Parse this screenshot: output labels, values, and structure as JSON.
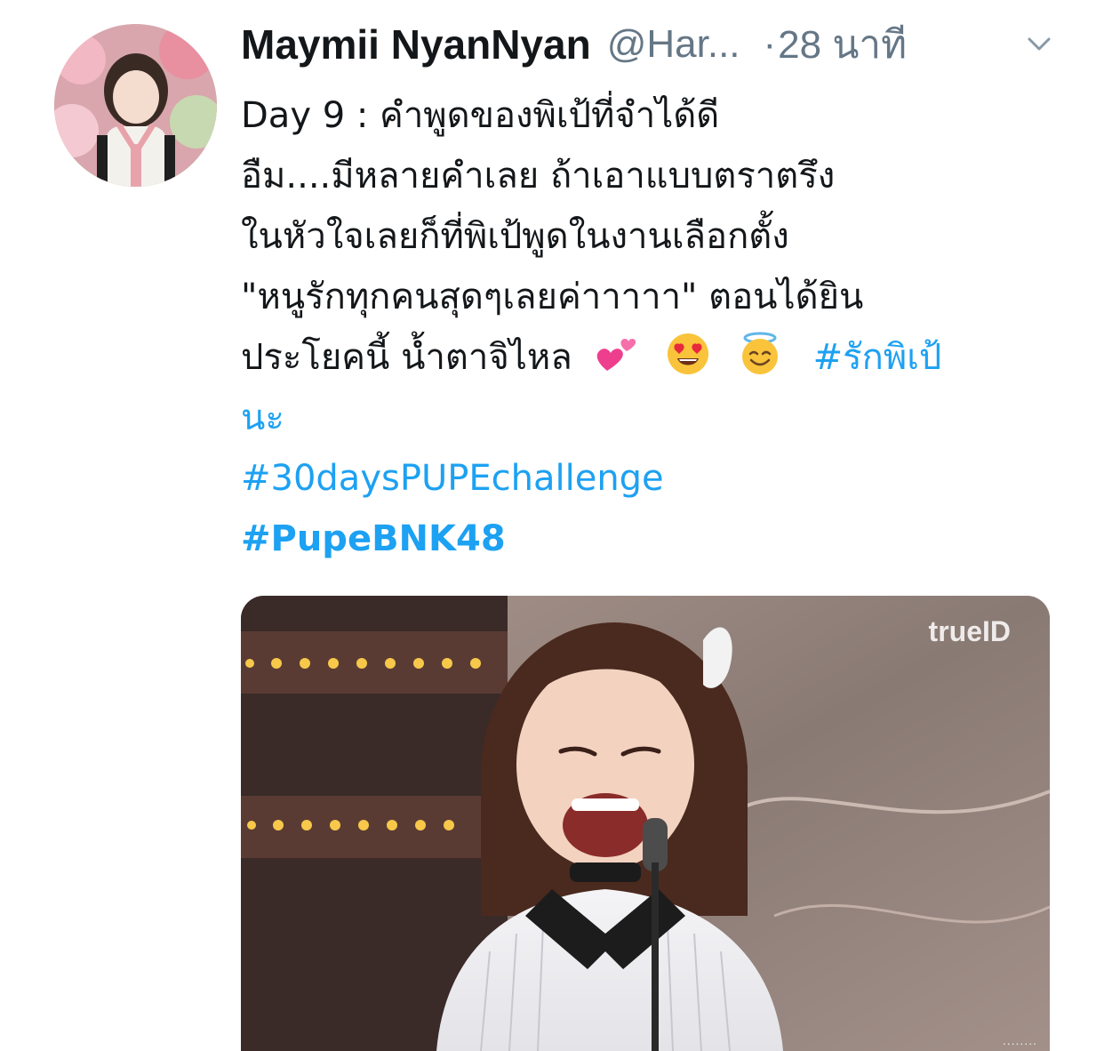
{
  "tweet": {
    "display_name": "Maymii NyanNyan",
    "handle": "@Har...",
    "separator": "·",
    "time": "28 นาที",
    "menu_icon": "chevron-down-icon",
    "text_lines": [
      "Day 9 : คำพูดของพิเป้ที่จำได้ดี",
      "อืม....มีหลายคำเลย ถ้าเอาแบบตราตรึง",
      "ในหัวใจเลยก็ที่พิเป้พูดในงานเลือกตั้ง",
      "\"หนูรักทุกคนสุดๆเลยค่าาาาา\" ตอนได้ยิน"
    ],
    "last_line_text": "ประโยคนี้ น้ำตาจิไหล",
    "emojis": [
      "two-hearts-icon",
      "heart-eyes-icon",
      "halo-smile-icon"
    ],
    "hashtag_inline": "#รักพิเป้",
    "hashtag_wrap": "นะ",
    "hashtag_2": "#30daysPUPEchallenge",
    "hashtag_3": "#PupeBNK48",
    "media": {
      "watermark": "trueID",
      "corner_dots": "........"
    }
  },
  "colors": {
    "text": "#14171a",
    "secondary": "#657786",
    "link": "#1da1f2"
  }
}
